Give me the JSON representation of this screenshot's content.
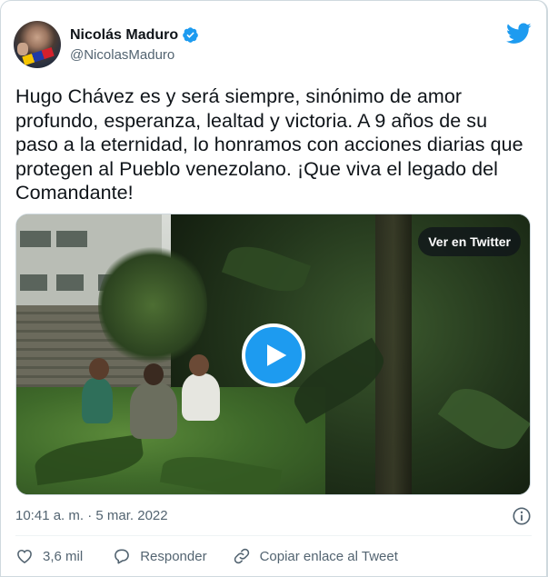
{
  "author": {
    "name": "Nicolás Maduro",
    "handle": "@NicolasMaduro",
    "verified": true
  },
  "tweet": {
    "text": "Hugo Chávez es y será siempre, sinónimo de amor\nprofundo, esperanza, lealtad y victoria. A 9 años de su\npaso a la eternidad, lo honramos con acciones diarias que\nprotegen al Pueblo venezolano. ¡Que viva el legado del\nComandante!",
    "timestamp": "10:41 a. m. · 5 mar. 2022"
  },
  "media": {
    "view_label": "Ver en Twitter"
  },
  "actions": {
    "likes": "3,6 mil",
    "reply_label": "Responder",
    "copy_label": "Copiar enlace al Tweet"
  },
  "icons": {
    "brand": "twitter-bird-icon",
    "verified": "verified-badge-icon",
    "play": "play-icon",
    "info": "info-icon",
    "like": "heart-icon",
    "reply": "reply-bubble-icon",
    "copy": "link-icon"
  },
  "colors": {
    "accent": "#1d9bf0",
    "text": "#0f1419",
    "muted": "#536471",
    "border": "#cfd9de"
  }
}
